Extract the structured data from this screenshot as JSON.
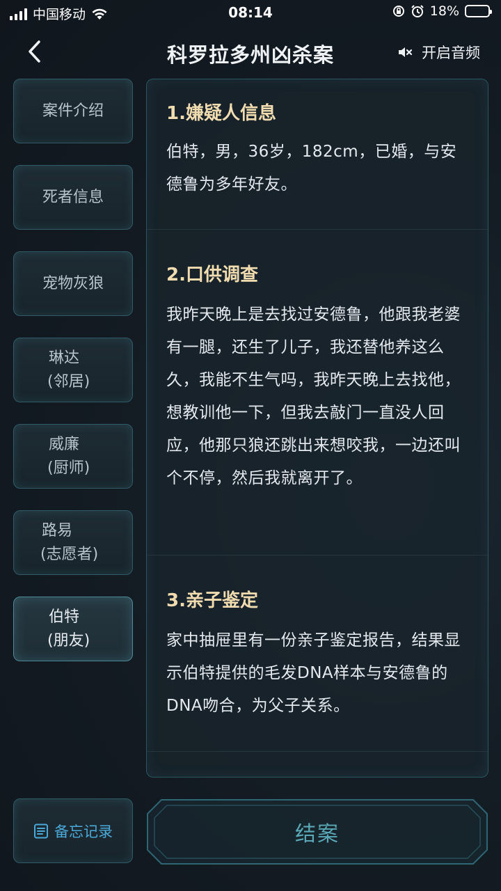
{
  "status_bar": {
    "carrier": "中国移动",
    "time": "08:14",
    "battery_pct": "18%",
    "battery_level": 0.18,
    "battery_color": "#ff3b30"
  },
  "header": {
    "back_icon": "chevron-left-icon",
    "title": "科罗拉多州凶杀案",
    "audio_icon": "speaker-muted-icon",
    "audio_label": "开启音频"
  },
  "nav": {
    "items": [
      {
        "line1": "案件介绍",
        "line2": ""
      },
      {
        "line1": "死者信息",
        "line2": ""
      },
      {
        "line1": "宠物灰狼",
        "line2": ""
      },
      {
        "line1": "琳达",
        "line2": "(邻居)"
      },
      {
        "line1": "威廉",
        "line2": "(厨师)"
      },
      {
        "line1": "路易",
        "line2": "(志愿者)"
      },
      {
        "line1": "伯特",
        "line2": "(朋友)"
      }
    ],
    "active_index": 6
  },
  "content": {
    "sections": [
      {
        "title": "1.嫌疑人信息",
        "body": "伯特，男，36岁，182cm，已婚，与安德鲁为多年好友。"
      },
      {
        "title": "2.口供调查",
        "body": "我昨天晚上是去找过安德鲁，他跟我老婆有一腿，还生了儿子，我还替他养这么久，我能不生气吗，我昨天晚上去找他，想教训他一下，但我去敲门一直没人回应，他那只狼还跳出来想咬我，一边还叫个不停，然后我就离开了。"
      },
      {
        "title": "3.亲子鉴定",
        "body": "家中抽屉里有一份亲子鉴定报告，结果显示伯特提供的毛发DNA样本与安德鲁的DNA吻合，为父子关系。"
      }
    ]
  },
  "footer": {
    "memo_icon": "notes-list-icon",
    "memo_label": "备忘记录",
    "close_case_label": "结案"
  },
  "colors": {
    "section_title": "#f1dcb0",
    "accent_blue": "#4aa9d8",
    "panel_border": "#2a5561"
  }
}
